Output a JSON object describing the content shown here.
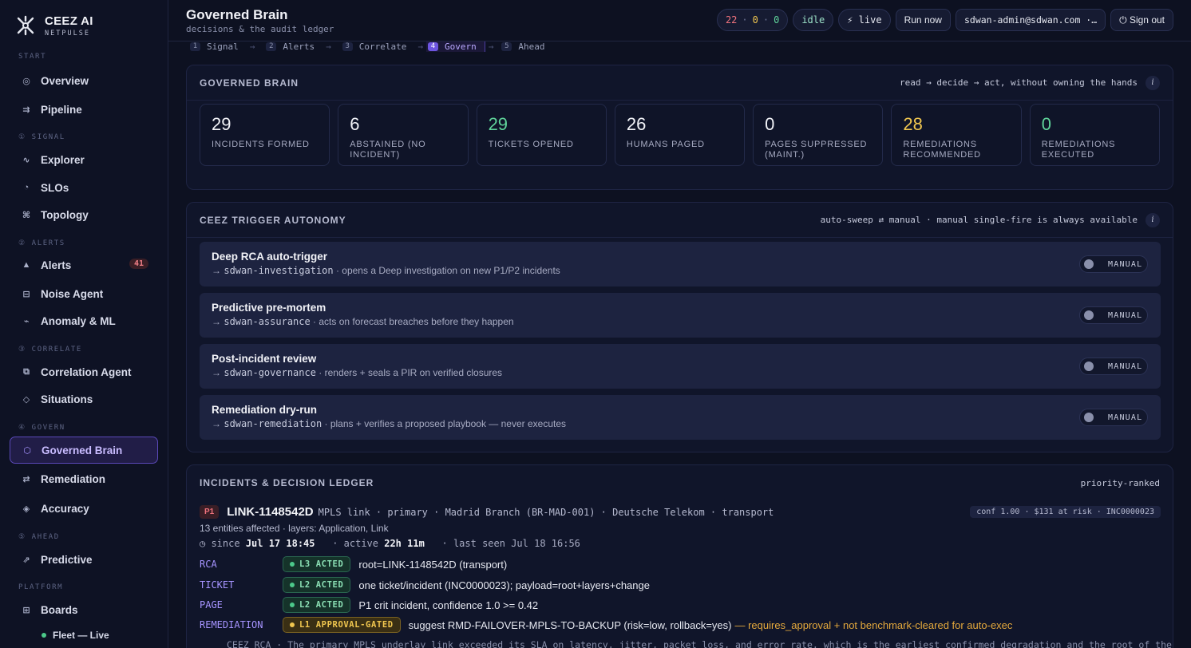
{
  "brand": {
    "name": "CEEZ AI",
    "sub": "NETPULSE"
  },
  "sidebar": {
    "sections": {
      "start": "START",
      "signal": "① SIGNAL",
      "alerts": "② ALERTS",
      "correlate": "③ CORRELATE",
      "govern": "④ GOVERN",
      "ahead": "⑤ AHEAD",
      "platform": "PLATFORM"
    },
    "items": [
      {
        "label": "Overview",
        "icon": "◎"
      },
      {
        "label": "Pipeline",
        "icon": "⇉"
      },
      {
        "label": "Explorer",
        "icon": "∿"
      },
      {
        "label": "SLOs",
        "icon": "◔"
      },
      {
        "label": "Topology",
        "icon": "⌘"
      },
      {
        "label": "Alerts",
        "icon": "▲",
        "count": "41"
      },
      {
        "label": "Noise Agent",
        "icon": "⊟"
      },
      {
        "label": "Anomaly & ML",
        "icon": "⌁"
      },
      {
        "label": "Correlation Agent",
        "icon": "⧉"
      },
      {
        "label": "Situations",
        "icon": "◇"
      },
      {
        "label": "Governed Brain",
        "icon": "⬡"
      },
      {
        "label": "Remediation",
        "icon": "⇄"
      },
      {
        "label": "Accuracy",
        "icon": "◈"
      },
      {
        "label": "Predictive",
        "icon": "⇗"
      },
      {
        "label": "Boards",
        "icon": "⊞"
      }
    ],
    "subitem": "Fleet — Live"
  },
  "header": {
    "title": "Governed Brain",
    "subtitle": "decisions & the audit ledger",
    "counts": {
      "red": "22",
      "amber": "0",
      "green": "0",
      "sep": "·"
    },
    "status": "idle",
    "live": "⚡ live",
    "run_now": "Run now",
    "user": "sdwan-admin@sdwan.com ·…",
    "sign_out": "⏻ Sign out"
  },
  "stepper": [
    {
      "num": "1",
      "label": "Signal"
    },
    {
      "num": "2",
      "label": "Alerts"
    },
    {
      "num": "3",
      "label": "Correlate"
    },
    {
      "num": "4",
      "label": "Govern"
    },
    {
      "num": "5",
      "label": "Ahead"
    }
  ],
  "brain": {
    "title": "GOVERNED BRAIN",
    "hint": "read → decide → act, without owning the hands",
    "stats": [
      {
        "value": "29",
        "label": "INCIDENTS FORMED",
        "color": "#f1f2f7"
      },
      {
        "value": "6",
        "label": "ABSTAINED (NO INCIDENT)",
        "color": "#f1f2f7"
      },
      {
        "value": "29",
        "label": "TICKETS OPENED",
        "color": "#5fd39a"
      },
      {
        "value": "26",
        "label": "HUMANS PAGED",
        "color": "#f1f2f7"
      },
      {
        "value": "0",
        "label": "PAGES SUPPRESSED (MAINT.)",
        "color": "#f1f2f7"
      },
      {
        "value": "28",
        "label": "REMEDIATIONS RECOMMENDED",
        "color": "#f0c64f"
      },
      {
        "value": "0",
        "label": "REMEDIATIONS EXECUTED",
        "color": "#5fd39a"
      }
    ]
  },
  "autonomy": {
    "title": "CEEZ TRIGGER AUTONOMY",
    "hint": "auto-sweep ⇄ manual · manual single-fire is always available",
    "rows": [
      {
        "title": "Deep RCA auto-trigger",
        "agent": "sdwan-investigation",
        "desc": " · opens a Deep investigation on new P1/P2 incidents",
        "mode": "MANUAL"
      },
      {
        "title": "Predictive pre-mortem",
        "agent": "sdwan-assurance",
        "desc": " · acts on forecast breaches before they happen",
        "mode": "MANUAL"
      },
      {
        "title": "Post-incident review",
        "agent": "sdwan-governance",
        "desc": " · renders + seals a PIR on verified closures",
        "mode": "MANUAL"
      },
      {
        "title": "Remediation dry-run",
        "agent": "sdwan-remediation",
        "desc": " · plans + verifies a proposed playbook — never executes",
        "mode": "MANUAL"
      }
    ]
  },
  "ledger": {
    "title": "INCIDENTS & DECISION LEDGER",
    "hint": "priority-ranked",
    "incident": {
      "priority": "P1",
      "id": "LINK-1148542D",
      "meta": "MPLS link · primary · Madrid Branch (BR-MAD-001) · Deutsche Telekom · transport",
      "conf": "conf 1.00 · $131 at risk · INC0000023",
      "affected": "13 entities affected · layers: Application, Link",
      "since_label": "◷ since",
      "since": "Jul 17 18:45",
      "active_label": "· active",
      "active": "22h 11m",
      "last_seen": "· last seen Jul 18 16:56",
      "rows": [
        {
          "key": "RCA",
          "level": "L3 ACTED",
          "kind": "green",
          "value": "root=LINK-1148542D (transport)",
          "warn": ""
        },
        {
          "key": "TICKET",
          "level": "L2 ACTED",
          "kind": "green",
          "value": "one ticket/incident (INC0000023); payload=root+layers+change",
          "warn": ""
        },
        {
          "key": "PAGE",
          "level": "L2 ACTED",
          "kind": "green",
          "value": "P1 crit incident, confidence 1.0 >= 0.42",
          "warn": ""
        },
        {
          "key": "REMEDIATION",
          "level": "L1 APPROVAL-GATED",
          "kind": "amber",
          "value": "suggest RMD-FAILOVER-MPLS-TO-BACKUP (risk=low, rollback=yes)",
          "warn": "— requires_approval + not benchmark-cleared for auto-exec"
        }
      ],
      "rca_text": "CEEZ RCA · The primary MPLS underlay link exceeded its SLA on latency, jitter, packet loss, and error rate, which is the earliest confirmed degradation and the root of the"
    }
  }
}
